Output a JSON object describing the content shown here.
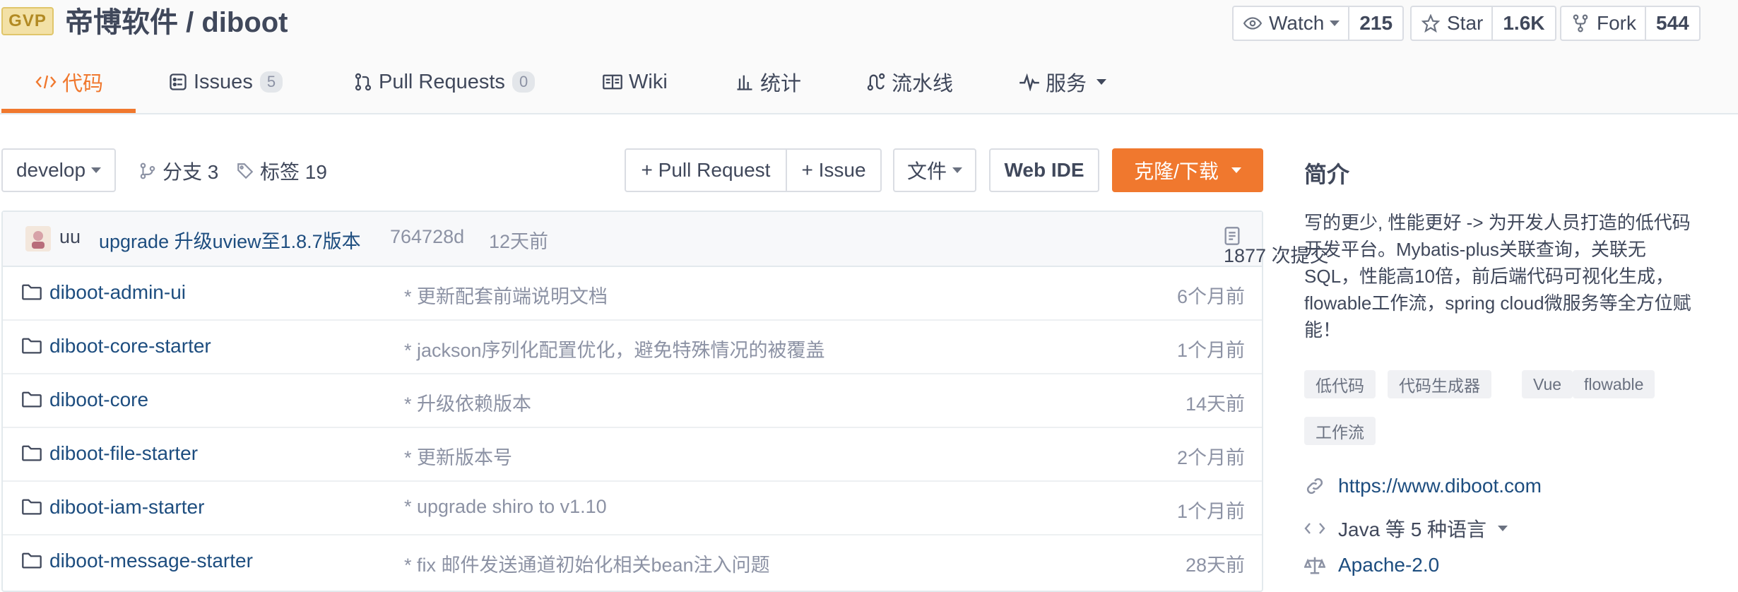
{
  "header": {
    "badge": "GVP",
    "repo_title": "帝博软件 / diboot",
    "watch": {
      "label": "Watch",
      "count": "215"
    },
    "star": {
      "label": "Star",
      "count": "1.6K"
    },
    "fork": {
      "label": "Fork",
      "count": "544"
    }
  },
  "tabs": [
    {
      "label": "代码",
      "icon": "code-icon",
      "active": true
    },
    {
      "label": "Issues",
      "badge": "5",
      "icon": "issues-icon"
    },
    {
      "label": "Pull Requests",
      "badge": "0",
      "icon": "pull-request-icon"
    },
    {
      "label": "Wiki",
      "icon": "book-icon"
    },
    {
      "label": "统计",
      "icon": "bar-chart-icon"
    },
    {
      "label": "流水线",
      "icon": "pipeline-icon"
    },
    {
      "label": "服务",
      "icon": "pulse-icon"
    }
  ],
  "toolbar": {
    "branch": "develop",
    "branches": "分支 3",
    "tags": "标签 19",
    "pull_request": "+ Pull Request",
    "issue": "+ Issue",
    "files": "文件",
    "web_ide": "Web IDE",
    "clone": "克隆/下载"
  },
  "commit": {
    "author": "uu",
    "message": "upgrade 升级uview至1.8.7版本",
    "hash": "764728d",
    "time": "12天前",
    "total": "1877 次提交"
  },
  "files": [
    {
      "name": "diboot-admin-ui",
      "message": "* 更新配套前端说明文档",
      "time": "6个月前"
    },
    {
      "name": "diboot-core-starter",
      "message": "* jackson序列化配置优化，避免特殊情况的被覆盖",
      "time": "1个月前"
    },
    {
      "name": "diboot-core",
      "message": "* 升级依赖版本",
      "time": "14天前"
    },
    {
      "name": "diboot-file-starter",
      "message": "* 更新版本号",
      "time": "2个月前"
    },
    {
      "name": "diboot-iam-starter",
      "message": "* upgrade shiro to v1.10",
      "time": "1个月前"
    },
    {
      "name": "diboot-message-starter",
      "message": "* fix 邮件发送通道初始化相关bean注入问题",
      "time": "28天前"
    }
  ],
  "sidebar": {
    "title": "简介",
    "description": "写的更少, 性能更好 -> 为开发人员打造的低代码开发平台。Mybatis-plus关联查询，关联无SQL，性能高10倍，前后端代码可视化生成，flowable工作流，spring cloud微服务等全方位赋能！",
    "tags": [
      "低代码",
      "代码生成器",
      "Vue",
      "flowable",
      "工作流"
    ],
    "website": "https://www.diboot.com",
    "languages": "Java 等 5 种语言",
    "license": "Apache-2.0"
  },
  "colors": {
    "accent": "#f0782e",
    "link": "#1d4d7f",
    "muted": "#8c92a4"
  }
}
